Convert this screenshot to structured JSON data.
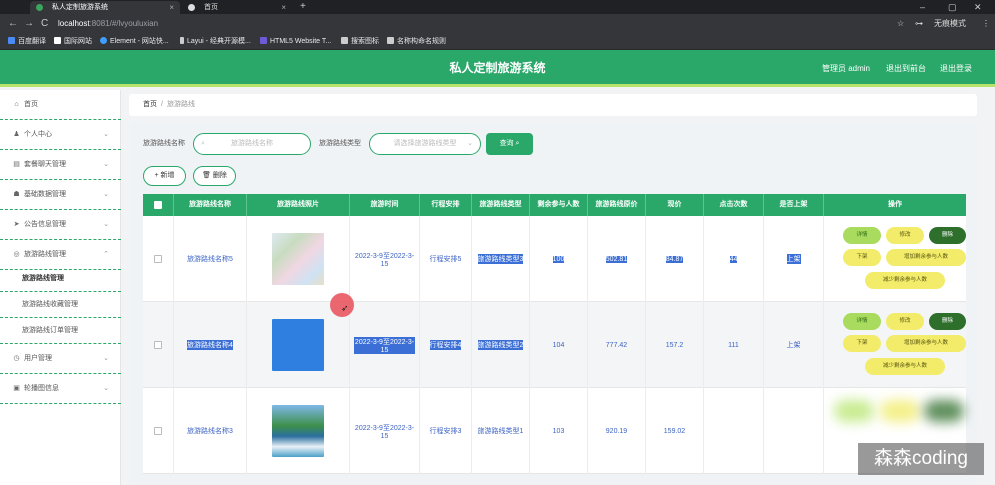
{
  "browser": {
    "tabs": [
      {
        "title": "私人定制旅游系统",
        "close": "×"
      },
      {
        "title": "首页",
        "close": "×"
      }
    ],
    "new_tab": "+",
    "window_controls": [
      "–",
      "▢",
      "✕"
    ],
    "nav": {
      "back": "←",
      "forward": "→",
      "reload": "C"
    },
    "url_host": "localhost",
    "url_rest": ":8081/#/lvyouluxian",
    "addr_right": [
      "☆",
      "⊶",
      "无痕模式",
      "⋮"
    ],
    "bookmarks": [
      "百度翻译",
      "国际网站",
      "Element - 网站快...",
      "Layui - 经典开源模...",
      "HTML5 Website T...",
      "搜索图标",
      "名称构命名规则"
    ]
  },
  "header": {
    "title": "私人定制旅游系统",
    "links": [
      "管理员 admin",
      "退出到前台",
      "退出登录"
    ],
    "colors": {
      "primary": "#2aa86a",
      "accent": "#b6e36a"
    }
  },
  "sidebar": {
    "items": [
      {
        "label": "首页",
        "icon": "home-icon",
        "glyph": "⌂",
        "chev": ""
      },
      {
        "label": "个人中心",
        "icon": "user-icon",
        "glyph": "♟",
        "chev": "⌄"
      },
      {
        "label": "套餐聊天管理",
        "icon": "chat-icon",
        "glyph": "▤",
        "chev": "⌄"
      },
      {
        "label": "基础数据管理",
        "icon": "database-icon",
        "glyph": "☗",
        "chev": "⌄"
      },
      {
        "label": "公告信息管理",
        "icon": "send-icon",
        "glyph": "➤",
        "chev": "⌄"
      },
      {
        "label": "旅游路线管理",
        "icon": "globe-icon",
        "glyph": "◎",
        "chev": "⌃"
      }
    ],
    "subitems": [
      "旅游路线管理",
      "旅游路线收藏管理",
      "旅游路线订单管理"
    ],
    "items_after": [
      {
        "label": "用户管理",
        "icon": "clock-icon",
        "glyph": "◷",
        "chev": "⌄"
      },
      {
        "label": "轮播图信息",
        "icon": "image-icon",
        "glyph": "▣",
        "chev": "⌄"
      }
    ]
  },
  "breadcrumb": {
    "home": "首页",
    "sep": "/",
    "current": "旅游路线"
  },
  "filters": {
    "name_label": "旅游路线名称",
    "name_placeholder": "旅游路线名称",
    "type_label": "旅游路线类型",
    "type_placeholder": "请选择旅游路线类型",
    "search_glyph": "⌕",
    "dropdown_glyph": "⌄",
    "query_button": "查询 ⌕",
    "add_button": "+ 新增",
    "delete_button": "🗑 删除"
  },
  "table": {
    "headers": [
      "旅游路线名称",
      "旅游路线照片",
      "旅游时间",
      "行程安排",
      "旅游路线类型",
      "剩余参与人数",
      "旅游路线原价",
      "现价",
      "点击次数",
      "是否上架",
      "操作"
    ],
    "rows": [
      {
        "name": "旅游路线名称5",
        "time": "2022-3-9至2022-3-15",
        "schedule": "行程安排5",
        "type": "旅游路线类型3",
        "remaining": "100",
        "orig_price": "502.81",
        "price": "84.87",
        "clicks": "44",
        "status": "上架"
      },
      {
        "name": "旅游路线名称4",
        "time": "2022-3-9至2022-3-15",
        "schedule": "行程安排4",
        "type": "旅游路线类型2",
        "remaining": "104",
        "orig_price": "777.42",
        "price": "157.2",
        "clicks": "111",
        "status": "上架"
      },
      {
        "name": "旅游路线名称3",
        "time": "2022-3-9至2022-3-15",
        "schedule": "行程安排3",
        "type": "旅游路线类型1",
        "remaining": "103",
        "orig_price": "920.19",
        "price": "159.02",
        "clicks": "",
        "status": ""
      }
    ],
    "row_actions": [
      "详情",
      "修改",
      "删除",
      "下架",
      "增加剩余参与人数",
      "减少剩余参与人数"
    ]
  },
  "watermark": "森森coding"
}
